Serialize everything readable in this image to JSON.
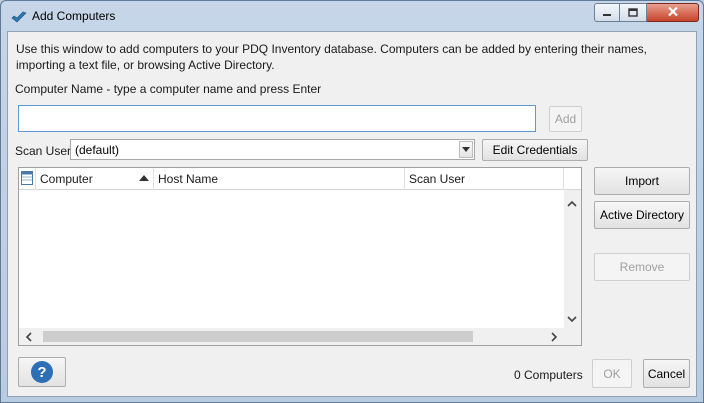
{
  "window": {
    "title": "Add Computers",
    "controls": {
      "minimize_icon": "minimize-icon",
      "maximize_icon": "maximize-icon",
      "close_icon": "close-icon"
    }
  },
  "description": "Use this window to add computers to your PDQ Inventory database. Computers can be added by entering their names, importing a text file, or browsing Active Directory.",
  "computer_name": {
    "label": "Computer Name - type a computer name and press Enter",
    "value": "",
    "add_label": "Add"
  },
  "scan_user": {
    "label": "Scan User",
    "selected": "(default)",
    "edit_credentials_label": "Edit Credentials"
  },
  "grid": {
    "columns": [
      "Computer",
      "Host Name",
      "Scan User"
    ],
    "sorted_column": "Computer",
    "sort_direction": "ascending",
    "rows": []
  },
  "side_buttons": {
    "import_label": "Import",
    "active_directory_label": "Active Directory",
    "remove_label": "Remove"
  },
  "footer": {
    "help_label": "?",
    "count_text": "0 Computers",
    "ok_label": "OK",
    "cancel_label": "Cancel"
  },
  "colors": {
    "accent": "#2c6fb5",
    "input_border": "#5a9bd5",
    "close_button": "#c7432b"
  }
}
